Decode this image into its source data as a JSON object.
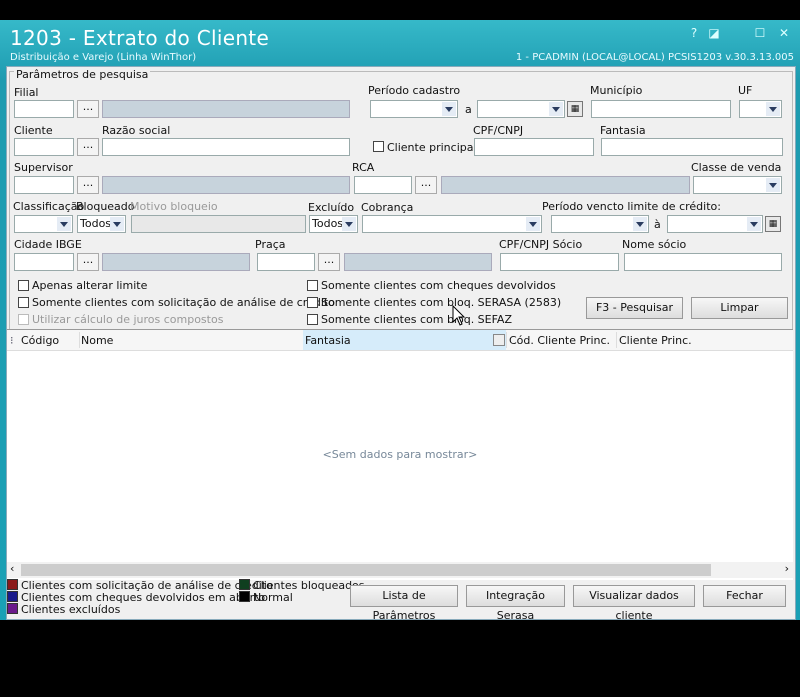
{
  "window": {
    "title": "1203 - Extrato do Cliente",
    "subtitle": "Distribuição e Varejo (Linha WinThor)",
    "status": "1 - PCADMIN (LOCAL@LOCAL)   PCSIS1203  v.30.3.13.005",
    "help_glyph": "?",
    "restore_glyph": "◪",
    "maximize_glyph": "☐",
    "close_glyph": "✕"
  },
  "filters": {
    "group_title": "Parâmetros de pesquisa",
    "filial": "Filial",
    "periodo_cadastro": "Período cadastro",
    "a_label": "a",
    "municipio": "Município",
    "uf": "UF",
    "cliente": "Cliente",
    "razao_social": "Razão social",
    "cliente_principal": "Cliente principal",
    "cpf_cnpj": "CPF/CNPJ",
    "fantasia": "Fantasia",
    "supervisor": "Supervisor",
    "rca": "RCA",
    "classe_venda": "Classe de venda",
    "classificacao": "Classificação",
    "bloqueado": "Bloqueado",
    "bloqueado_value": "Todos",
    "motivo_bloqueio": "Motivo bloqueio",
    "excluido": "Excluído",
    "excluido_value": "Todos",
    "cobranca": "Cobrança",
    "periodo_vencto": "Período vencto limite de crédito:",
    "a_accent_label": "à",
    "cidade_ibge": "Cidade IBGE",
    "praca": "Praça",
    "cpf_cnpj_socio": "CPF/CNPJ Sócio",
    "nome_socio": "Nome sócio",
    "ellipsis": "...",
    "calendar_glyph": "▦"
  },
  "options": {
    "apenas_alterar_limite": "Apenas alterar limite",
    "solicitacao_analise": "Somente clientes com solicitação de análise de crédito",
    "juros_compostos": "Utilizar cálculo de juros compostos",
    "cheques_devolvidos": "Somente clientes com cheques devolvidos",
    "bloq_serasa": "Somente clientes com bloq. SERASA (2583)",
    "bloq_sefaz": "Somente clientes com bloq. SEFAZ"
  },
  "buttons": {
    "pesquisar": "F3 - Pesquisar",
    "limpar": "Limpar",
    "lista_parametros": "Lista de Parâmetros",
    "integracao_serasa": "Integração Serasa",
    "visualizar_dados": "Visualizar dados cliente",
    "fechar": "Fechar"
  },
  "grid": {
    "columns": [
      "Código",
      "Nome",
      "Fantasia",
      "Cód. Cliente Princ.",
      "Cliente Princ."
    ],
    "empty_text": "<Sem dados para mostrar>",
    "scroll_left": "‹",
    "scroll_right": "›",
    "row_indicator": "⁝"
  },
  "legend": [
    {
      "label": "Clientes com solicitação de análise de crédito",
      "color": "#8b1a1a"
    },
    {
      "label": "Clientes com cheques devolvidos em aberto",
      "color": "#1a1a8b"
    },
    {
      "label": "Clientes excluídos",
      "color": "#6a1a8b"
    },
    {
      "label": "Clientes bloqueados",
      "color": "#0f3f1f"
    },
    {
      "label": "Normal",
      "color": "#000000"
    }
  ]
}
